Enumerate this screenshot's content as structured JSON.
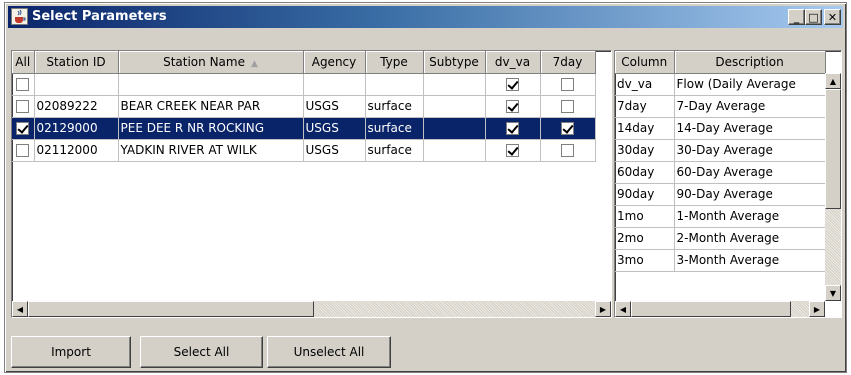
{
  "window": {
    "title": "Select Parameters",
    "controls": {
      "minimize": "_",
      "maximize": "□",
      "close": "✕"
    }
  },
  "main_table": {
    "columns": [
      "All",
      "Station ID",
      "Station Name",
      "Agency",
      "Type",
      "Subtype",
      "dv_va",
      "7day"
    ],
    "sorted_column": "Station Name",
    "rows": [
      {
        "all": false,
        "station_id": "",
        "station_name": "",
        "agency": "",
        "type": "",
        "subtype": "",
        "dv_va": true,
        "seven_day": false,
        "selected": false
      },
      {
        "all": false,
        "station_id": "02089222",
        "station_name": "BEAR CREEK NEAR PAR",
        "agency": "USGS",
        "type": "surface",
        "subtype": "",
        "dv_va": true,
        "seven_day": false,
        "selected": false
      },
      {
        "all": true,
        "station_id": "02129000",
        "station_name": "PEE DEE R NR ROCKING",
        "agency": "USGS",
        "type": "surface",
        "subtype": "",
        "dv_va": true,
        "seven_day": true,
        "selected": true
      },
      {
        "all": false,
        "station_id": "02112000",
        "station_name": "YADKIN RIVER AT WILK",
        "agency": "USGS",
        "type": "surface",
        "subtype": "",
        "dv_va": true,
        "seven_day": false,
        "selected": false
      }
    ]
  },
  "column_table": {
    "columns": [
      "Column",
      "Description"
    ],
    "rows": [
      {
        "column": "dv_va",
        "description": "Flow (Daily Average"
      },
      {
        "column": "7day",
        "description": "7-Day Average"
      },
      {
        "column": "14day",
        "description": "14-Day Average"
      },
      {
        "column": "30day",
        "description": "30-Day Average"
      },
      {
        "column": "60day",
        "description": "60-Day Average"
      },
      {
        "column": "90day",
        "description": "90-Day Average"
      },
      {
        "column": "1mo",
        "description": "1-Month Average"
      },
      {
        "column": "2mo",
        "description": "2-Month Average"
      },
      {
        "column": "3mo",
        "description": "3-Month Average"
      }
    ]
  },
  "buttons": {
    "import": "Import",
    "select_all": "Select All",
    "unselect_all": "Unselect All"
  },
  "icons": {
    "app": "java-cup-icon",
    "sort": "sort-ascending-icon",
    "scroll_left": "arrow-left-icon",
    "scroll_right": "arrow-right-icon",
    "scroll_up": "arrow-up-icon",
    "scroll_down": "arrow-down-icon"
  },
  "colors": {
    "title_gradient_start": "#0a246a",
    "title_gradient_end": "#a6caf0",
    "selection": "#0a246a",
    "face": "#d4d0c8"
  }
}
